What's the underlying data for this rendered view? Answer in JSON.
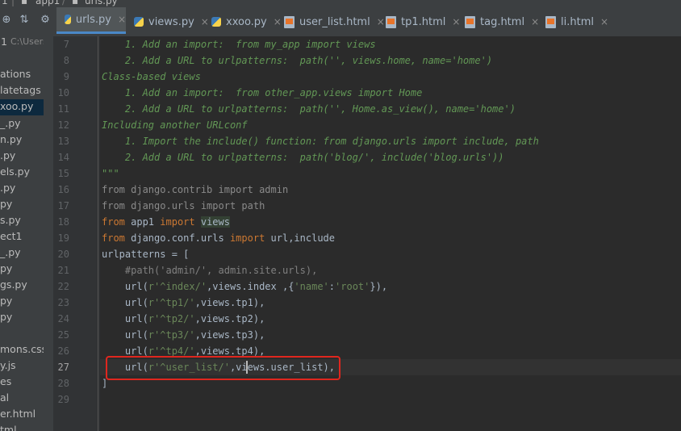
{
  "breadcrumb": {
    "items": [
      "1",
      "app1",
      "urls.py"
    ]
  },
  "toolbar": {
    "icons": [
      "settings-icon",
      "collapse-icon",
      "gear-icon"
    ]
  },
  "tabs": [
    {
      "label": "urls.py",
      "type": "python",
      "active": true
    },
    {
      "label": "views.py",
      "type": "python",
      "active": false
    },
    {
      "label": "xxoo.py",
      "type": "python",
      "active": false
    },
    {
      "label": "user_list.html",
      "type": "html",
      "active": false
    },
    {
      "label": "tp1.html",
      "type": "html",
      "active": false
    },
    {
      "label": "tag.html",
      "type": "html",
      "active": false
    },
    {
      "label": "li.html",
      "type": "html",
      "active": false
    }
  ],
  "project": {
    "root_label": "1",
    "root_path": "C:\\Users",
    "items": [
      "ations",
      "latetags",
      "xoo.py",
      "_.py",
      "n.py",
      ".py",
      "els.py",
      ".py",
      "py",
      "s.py",
      "ect1",
      "_.py",
      "py",
      "gs.py",
      "py",
      "py",
      "",
      "mons.css",
      "y.js",
      "es",
      "al",
      "er.html",
      "tml"
    ],
    "selected_item": "xoo.py"
  },
  "editor": {
    "line_numbers": [
      "7",
      "8",
      "9",
      "10",
      "11",
      "12",
      "13",
      "14",
      "15",
      "16",
      "17",
      "18",
      "19",
      "20",
      "21",
      "22",
      "23",
      "24",
      "25",
      "26",
      "27",
      "28",
      "29"
    ],
    "current_line": "27",
    "lines": {
      "l7": "    1. Add an import:  from my_app import views",
      "l8": "    2. Add a URL to urlpatterns:  path('', views.home, name='home')",
      "l9": "Class-based views",
      "l10": "    1. Add an import:  from other_app.views import Home",
      "l11": "    2. Add a URL to urlpatterns:  path('', Home.as_view(), name='home')",
      "l12": "Including another URLconf",
      "l13": "    1. Import the include() function: from django.urls import include, path",
      "l14": "    2. Add a URL to urlpatterns:  path('blog/', include('blog.urls'))",
      "l15": "\"\"\"",
      "l16": "from django.contrib import admin",
      "l17": "from django.urls import path",
      "l18_from": "from",
      "l18_mod": " app1 ",
      "l18_import": "import",
      "l18_name": "views",
      "l19_from": "from",
      "l19_mod": " django.conf.urls ",
      "l19_import": "import",
      "l19_names": " url,include",
      "l20": "urlpatterns = [",
      "l21": "    #path('admin/', admin.site.urls),",
      "l22_pre": "    url(",
      "l22_str": "r'^index/'",
      "l22_mid": ",views.index ,{",
      "l22_k": "'name'",
      "l22_colon": ":",
      "l22_v": "'root'",
      "l22_end": "}),",
      "l23_pre": "    url(",
      "l23_str": "r'^tp1/'",
      "l23_end": ",views.tp1),",
      "l24_pre": "    url(",
      "l24_str": "r'^tp2/'",
      "l24_end": ",views.tp2),",
      "l25_pre": "    url(",
      "l25_str": "r'^tp3/'",
      "l25_end": ",views.tp3),",
      "l26_pre": "    url(",
      "l26_str": "r'^tp4/'",
      "l26_end": ",views.tp4),",
      "l27_pre": "    url(",
      "l27_str": "r'^user_list/'",
      "l27_end": ",views.user_list),",
      "l28": "]",
      "l29": ""
    }
  },
  "colors": {
    "annotation_box": "#e0261e",
    "keyword": "#cc7832",
    "string": "#6a8759",
    "docstring": "#629755",
    "comment": "#808080"
  }
}
